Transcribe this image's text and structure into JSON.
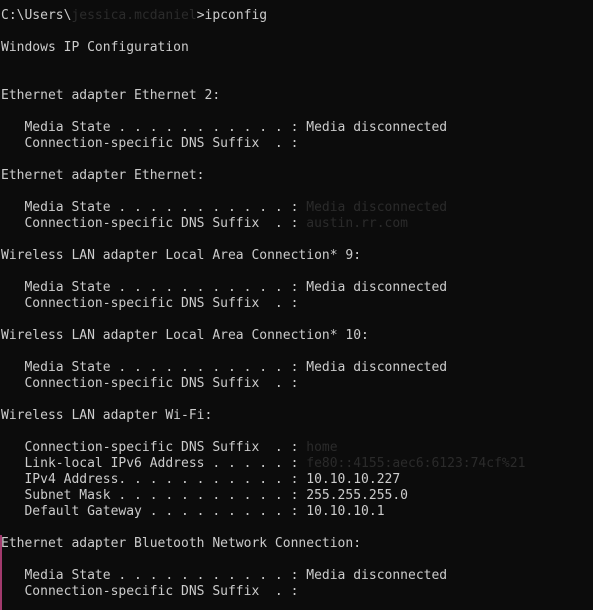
{
  "terminal": {
    "background_color": "#0c0c0c",
    "text_color": "#cccccc",
    "dim_color": "#2b2b2b",
    "marker_color": "#a23a6d",
    "prompt": {
      "path_prefix": "C:\\Users\\",
      "username": "jessica.mcdaniel",
      "separator": ">",
      "command": "ipconfig"
    },
    "heading": "Windows IP Configuration",
    "sections": [
      {
        "title": "Ethernet adapter Ethernet 2:",
        "rows": [
          {
            "label": "Media State . . . . . . . . . . . :",
            "value": "Media disconnected",
            "dim": false
          },
          {
            "label": "Connection-specific DNS Suffix  . :",
            "value": "",
            "dim": false
          }
        ]
      },
      {
        "title": "Ethernet adapter Ethernet:",
        "rows": [
          {
            "label": "Media State . . . . . . . . . . . :",
            "value": "Media disconnected",
            "dim": true
          },
          {
            "label": "Connection-specific DNS Suffix  . :",
            "value": "austin.rr.com",
            "dim": true
          }
        ]
      },
      {
        "title": "Wireless LAN adapter Local Area Connection* 9:",
        "rows": [
          {
            "label": "Media State . . . . . . . . . . . :",
            "value": "Media disconnected",
            "dim": false
          },
          {
            "label": "Connection-specific DNS Suffix  . :",
            "value": "",
            "dim": false
          }
        ]
      },
      {
        "title": "Wireless LAN adapter Local Area Connection* 10:",
        "rows": [
          {
            "label": "Media State . . . . . . . . . . . :",
            "value": "Media disconnected",
            "dim": false
          },
          {
            "label": "Connection-specific DNS Suffix  . :",
            "value": "",
            "dim": false
          }
        ]
      },
      {
        "title": "Wireless LAN adapter Wi-Fi:",
        "rows": [
          {
            "label": "Connection-specific DNS Suffix  . :",
            "value": "home",
            "dim": true
          },
          {
            "label": "Link-local IPv6 Address . . . . . :",
            "value": "fe80::4155:aec6:6123:74cf%21",
            "dim": true
          },
          {
            "label": "IPv4 Address. . . . . . . . . . . :",
            "value": "10.10.10.227",
            "dim": false
          },
          {
            "label": "Subnet Mask . . . . . . . . . . . :",
            "value": "255.255.255.0",
            "dim": false
          },
          {
            "label": "Default Gateway . . . . . . . . . :",
            "value": "10.10.10.1",
            "dim": false
          }
        ]
      },
      {
        "title": "Ethernet adapter Bluetooth Network Connection:",
        "rows": [
          {
            "label": "Media State . . . . . . . . . . . :",
            "value": "Media disconnected",
            "dim": false
          },
          {
            "label": "Connection-specific DNS Suffix  . :",
            "value": "",
            "dim": false
          }
        ]
      }
    ]
  }
}
